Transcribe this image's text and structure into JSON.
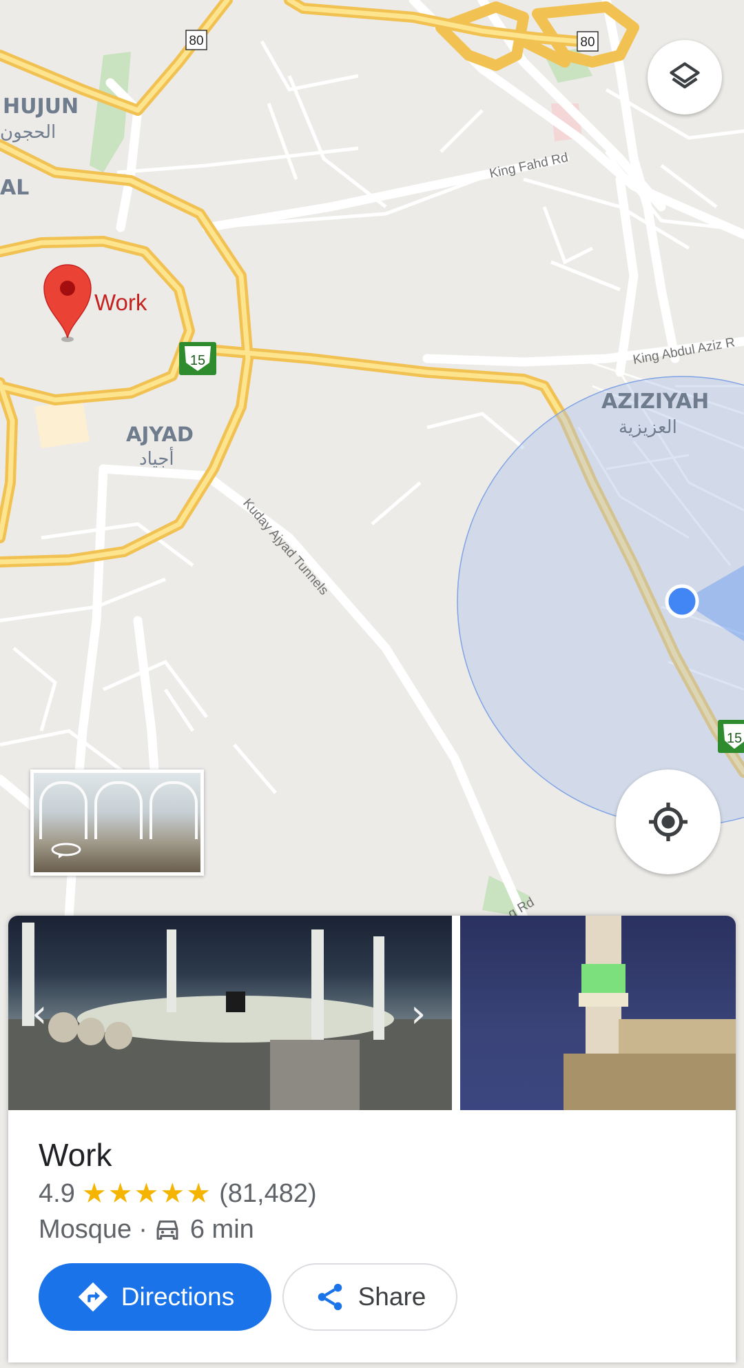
{
  "map": {
    "districts": [
      "HUJUN",
      "AJYAD",
      "AZIZIYAH",
      "AL"
    ],
    "districts_arabic": [
      "الحجون",
      "أجياد",
      "العزيزية"
    ],
    "roads": [
      "King Fahd Rd",
      "King Abdul Aziz R",
      "Kuday Ajyad Tunnels",
      "g Rd"
    ],
    "route_shields": [
      "80",
      "80",
      "15",
      "15"
    ],
    "pin_label": "Work",
    "colors": {
      "land": "#ecebe8",
      "highway": "#fbd66a",
      "accuracy_circle": "#aec4ea",
      "my_location": "#4285f4",
      "pin": "#ea4335"
    }
  },
  "controls": {
    "layers_icon": "layers-icon",
    "locate_icon": "my-location-icon",
    "streetview_icon": "360-rotate-icon"
  },
  "place": {
    "title": "Work",
    "rating": "4.9",
    "stars": "★★★★★",
    "reviews": "(81,482)",
    "category": "Mosque",
    "separator": "·",
    "drive_time": "6 min",
    "photo_prev_arrow": "‹",
    "photo_next_arrow": "›",
    "directions_label": "Directions",
    "share_label": "Share",
    "accent_color": "#1a73e8",
    "star_color": "#f4b400"
  }
}
